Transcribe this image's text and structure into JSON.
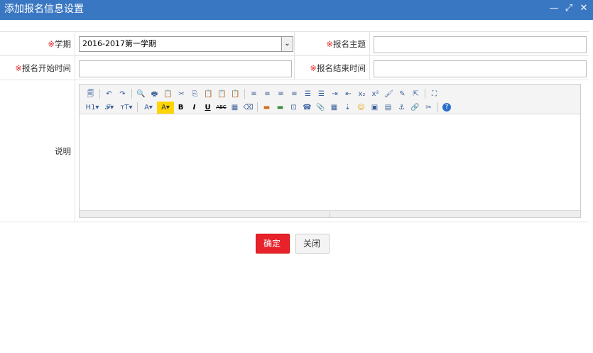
{
  "window": {
    "title": "添加报名信息设置",
    "controls": [
      "—",
      "⤢",
      "✕"
    ]
  },
  "form": {
    "req_mark": "※",
    "term_label": "学期",
    "term_value": "2016-2017第一学期",
    "topic_label": "报名主题",
    "topic_value": "",
    "start_label": "报名开始时间",
    "start_value": "",
    "end_label": "报名结束时间",
    "end_value": "",
    "desc_label": "说明"
  },
  "editor": {
    "row1": [
      "🗐",
      "↶",
      "↷",
      "🔍",
      "🖶",
      "📋",
      "✂",
      "⎘",
      "📋",
      "📋",
      "📋",
      "≡",
      "≡",
      "≡",
      "≡",
      "☰",
      "☰",
      "⇥",
      "⇤",
      "x₂",
      "x²",
      "🖌",
      "✎",
      "⇱",
      "⛶"
    ],
    "row2": [
      "H1▾",
      "𝓕▾",
      "тT▾",
      "A▾",
      "A▾",
      "B",
      "I",
      "U",
      "ABC",
      "▦",
      "⌫",
      "▬",
      "▬",
      "⊡",
      "☎",
      "📎",
      "▦",
      "⇣",
      "☺",
      "▣",
      "▤",
      "⚓",
      "🔗",
      "✂",
      "?"
    ],
    "resize_glyph": "⋮"
  },
  "buttons": {
    "ok": "确定",
    "close": "关闭"
  }
}
